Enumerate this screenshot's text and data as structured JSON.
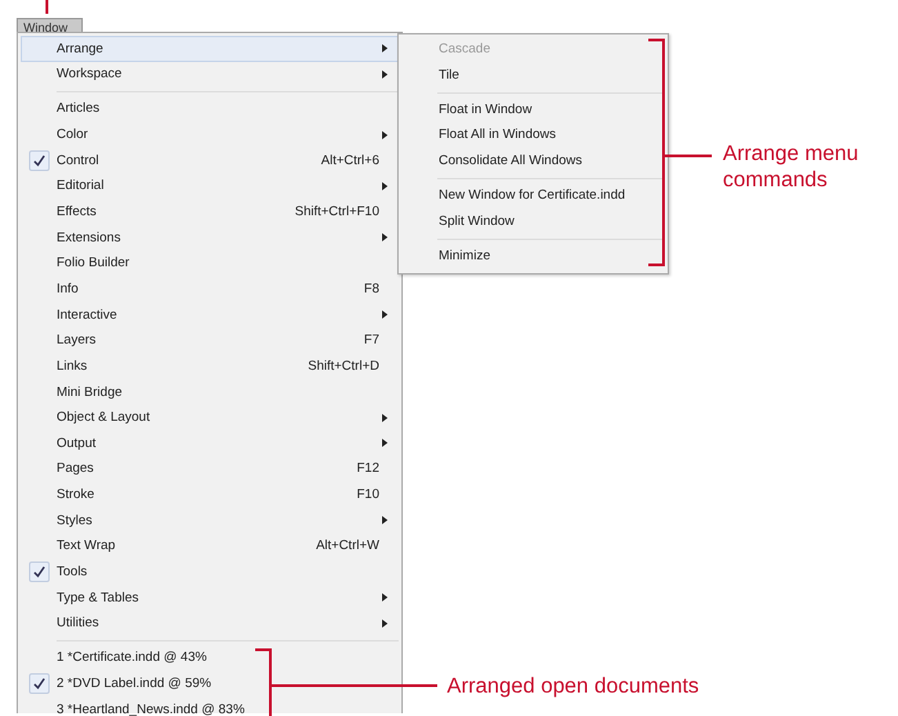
{
  "menu": {
    "title": "Window",
    "groups": [
      [
        {
          "label": "Arrange",
          "submenu": true,
          "checked": false,
          "selected": true
        },
        {
          "label": "Workspace",
          "submenu": true,
          "checked": false,
          "selected": false
        }
      ],
      [
        {
          "label": "Articles",
          "submenu": false,
          "checked": false,
          "selected": false
        },
        {
          "label": "Color",
          "submenu": true,
          "checked": false,
          "selected": false
        },
        {
          "label": "Control",
          "shortcut": "Alt+Ctrl+6",
          "submenu": false,
          "checked": true,
          "selected": false
        },
        {
          "label": "Editorial",
          "submenu": true,
          "checked": false,
          "selected": false
        },
        {
          "label": "Effects",
          "shortcut": "Shift+Ctrl+F10",
          "submenu": false,
          "checked": false,
          "selected": false
        },
        {
          "label": "Extensions",
          "submenu": true,
          "checked": false,
          "selected": false
        },
        {
          "label": "Folio Builder",
          "submenu": false,
          "checked": false,
          "selected": false
        },
        {
          "label": "Info",
          "shortcut": "F8",
          "submenu": false,
          "checked": false,
          "selected": false
        },
        {
          "label": "Interactive",
          "submenu": true,
          "checked": false,
          "selected": false
        },
        {
          "label": "Layers",
          "shortcut": "F7",
          "submenu": false,
          "checked": false,
          "selected": false
        },
        {
          "label": "Links",
          "shortcut": "Shift+Ctrl+D",
          "submenu": false,
          "checked": false,
          "selected": false
        },
        {
          "label": "Mini Bridge",
          "submenu": false,
          "checked": false,
          "selected": false
        },
        {
          "label": "Object & Layout",
          "submenu": true,
          "checked": false,
          "selected": false
        },
        {
          "label": "Output",
          "submenu": true,
          "checked": false,
          "selected": false
        },
        {
          "label": "Pages",
          "shortcut": "F12",
          "submenu": false,
          "checked": false,
          "selected": false
        },
        {
          "label": "Stroke",
          "shortcut": "F10",
          "submenu": false,
          "checked": false,
          "selected": false
        },
        {
          "label": "Styles",
          "submenu": true,
          "checked": false,
          "selected": false
        },
        {
          "label": "Text Wrap",
          "shortcut": "Alt+Ctrl+W",
          "submenu": false,
          "checked": false,
          "selected": false
        },
        {
          "label": "Tools",
          "submenu": false,
          "checked": true,
          "selected": false
        },
        {
          "label": "Type & Tables",
          "submenu": true,
          "checked": false,
          "selected": false
        },
        {
          "label": "Utilities",
          "submenu": true,
          "checked": false,
          "selected": false
        }
      ],
      [
        {
          "label": "1 *Certificate.indd @ 43%",
          "submenu": false,
          "checked": false,
          "selected": false
        },
        {
          "label": "2 *DVD Label.indd @ 59%",
          "submenu": false,
          "checked": true,
          "selected": false
        },
        {
          "label": "3 *Heartland_News.indd @ 83%",
          "submenu": false,
          "checked": false,
          "selected": false
        }
      ]
    ]
  },
  "arrange_submenu": {
    "groups": [
      [
        {
          "label": "Cascade",
          "disabled": true
        },
        {
          "label": "Tile",
          "disabled": false
        }
      ],
      [
        {
          "label": "Float in Window",
          "disabled": false
        },
        {
          "label": "Float All in Windows",
          "disabled": false
        },
        {
          "label": "Consolidate All Windows",
          "disabled": false
        }
      ],
      [
        {
          "label": "New Window for Certificate.indd",
          "disabled": false
        },
        {
          "label": "Split Window",
          "disabled": false
        }
      ],
      [
        {
          "label": "Minimize",
          "disabled": false
        }
      ]
    ]
  },
  "callouts": [
    {
      "text": "Arrange menu commands"
    },
    {
      "text": "Arranged open documents"
    }
  ]
}
